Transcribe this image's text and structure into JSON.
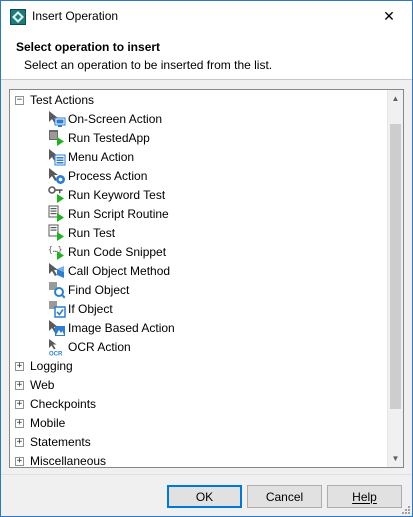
{
  "window": {
    "title": "Insert Operation",
    "close_glyph": "✕"
  },
  "header": {
    "title": "Select operation to insert",
    "subtitle": "Select an operation to be inserted from the list."
  },
  "tree": {
    "expanded_group": {
      "label": "Test Actions",
      "expander": "−",
      "items": [
        {
          "label": "On-Screen Action",
          "icon": "monitor-cursor-icon"
        },
        {
          "label": "Run TestedApp",
          "icon": "run-app-icon"
        },
        {
          "label": "Menu Action",
          "icon": "menu-cursor-icon"
        },
        {
          "label": "Process Action",
          "icon": "gear-cursor-icon"
        },
        {
          "label": "Run Keyword Test",
          "icon": "key-run-icon"
        },
        {
          "label": "Run Script Routine",
          "icon": "script-run-icon"
        },
        {
          "label": "Run Test",
          "icon": "test-run-icon"
        },
        {
          "label": "Run Code Snippet",
          "icon": "code-snippet-run-icon"
        },
        {
          "label": "Call Object Method",
          "icon": "call-method-icon"
        },
        {
          "label": "Find Object",
          "icon": "find-object-icon"
        },
        {
          "label": "If Object",
          "icon": "if-object-icon"
        },
        {
          "label": "Image Based Action",
          "icon": "image-cursor-icon"
        },
        {
          "label": "OCR Action",
          "icon": "ocr-cursor-icon"
        }
      ]
    },
    "collapsed_groups": [
      {
        "label": "Logging",
        "expander": "+"
      },
      {
        "label": "Web",
        "expander": "+"
      },
      {
        "label": "Checkpoints",
        "expander": "+"
      },
      {
        "label": "Mobile",
        "expander": "+"
      },
      {
        "label": "Statements",
        "expander": "+"
      },
      {
        "label": "Miscellaneous",
        "expander": "+"
      }
    ],
    "scroll_up_glyph": "▲",
    "scroll_down_glyph": "▼"
  },
  "buttons": {
    "ok": "OK",
    "cancel": "Cancel",
    "help": "Help"
  },
  "colors": {
    "accent": "#0078d7",
    "play_green": "#1bb51b",
    "blue_icon": "#2a7fd4"
  }
}
